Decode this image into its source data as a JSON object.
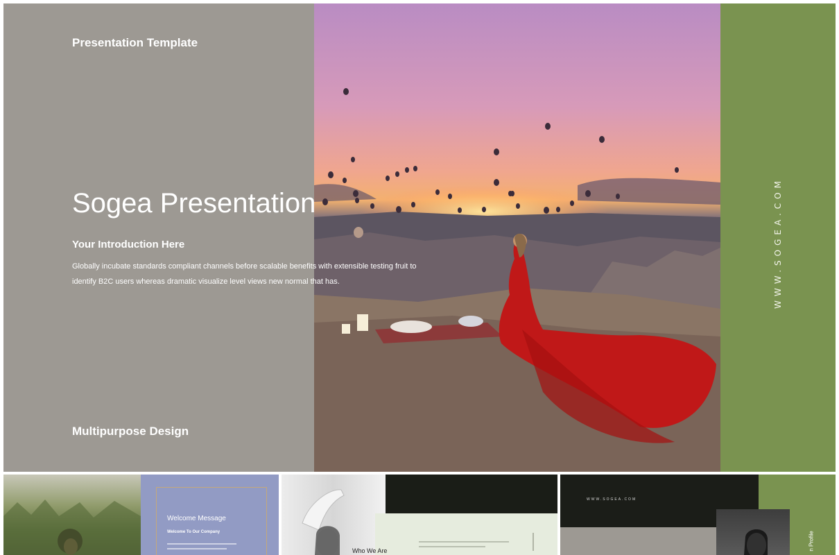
{
  "slide": {
    "template_label": "Presentation Template",
    "title": "Sogea Presentation",
    "intro_heading": "Your Introduction Here",
    "body_text": "Globally incubate standards compliant channels before scalable benefits with extensible testing fruit to identify B2C users whereas dramatic visualize level views new normal that has.",
    "footer_label": "Multipurpose Design",
    "website_vertical": "WWW.SOGEA.COM"
  },
  "thumbnails": [
    {
      "heading": "Welcome Message",
      "subheading": "Welcome To Our Company"
    },
    {
      "heading": "Who We Are"
    },
    {
      "url": "WWW.SOGEA.COM",
      "side_label": "n Profile"
    }
  ],
  "colors": {
    "left_panel": "#9d9993",
    "green_panel": "#7a9350",
    "dark_panel": "#1b1d18",
    "lavender_panel": "#929bc4"
  },
  "icons": [
    "hot-air-balloon",
    "photo-woman-red-dress"
  ]
}
